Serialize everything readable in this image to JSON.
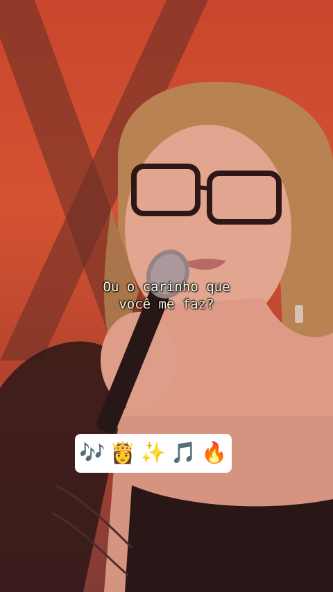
{
  "caption": {
    "line1": "Ou o carinho que",
    "line2": "você me faz?"
  },
  "emoji_bar": {
    "emojis": [
      "🎶",
      "👸",
      "✨",
      "🎵",
      "🔥"
    ]
  },
  "colors": {
    "stage_background": "#d9542f",
    "caption_text": "#fffbe0",
    "emoji_bar_background": "#ffffff"
  }
}
